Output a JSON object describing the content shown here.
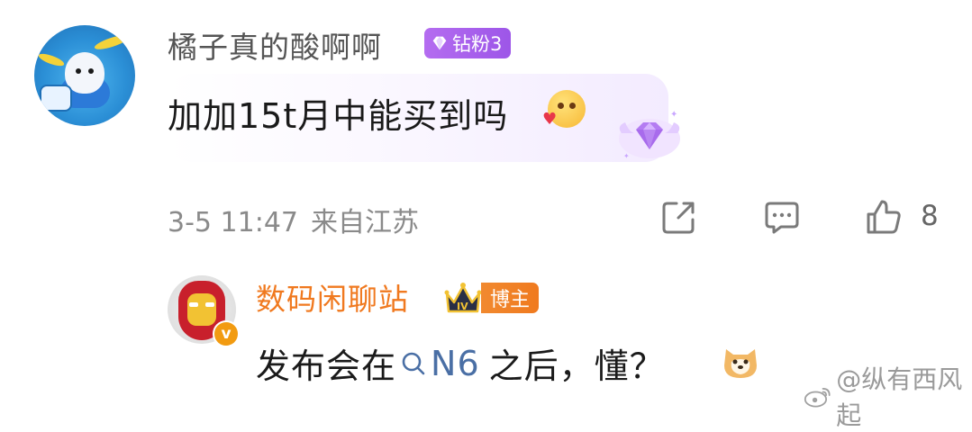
{
  "comment1": {
    "username": "橘子真的酸啊啊",
    "badge_label": "钻粉3",
    "text": "加加15t月中能买到吗",
    "timestamp": "3-5 11:47",
    "location": "来自江苏",
    "like_count": "8"
  },
  "comment2": {
    "username": "数码闲聊站",
    "badge_label": "博主",
    "crown_level": "IV",
    "verified_mark": "v",
    "text_before": "发布会在",
    "search_term": "N6",
    "text_after": "之后，懂？"
  },
  "watermark": {
    "text": "@纵有西风起"
  },
  "colors": {
    "username_gray": "#555555",
    "blogger_orange": "#f0791f",
    "badge_purple": "#a35eea",
    "search_link_blue": "#4a6fa5",
    "meta_gray": "#8a8a8a"
  },
  "icons": {
    "share": "share-icon",
    "reply": "comment-icon",
    "like": "thumbs-up-icon",
    "search": "search-icon",
    "diamond": "diamond-icon",
    "weibo": "weibo-logo-icon"
  }
}
